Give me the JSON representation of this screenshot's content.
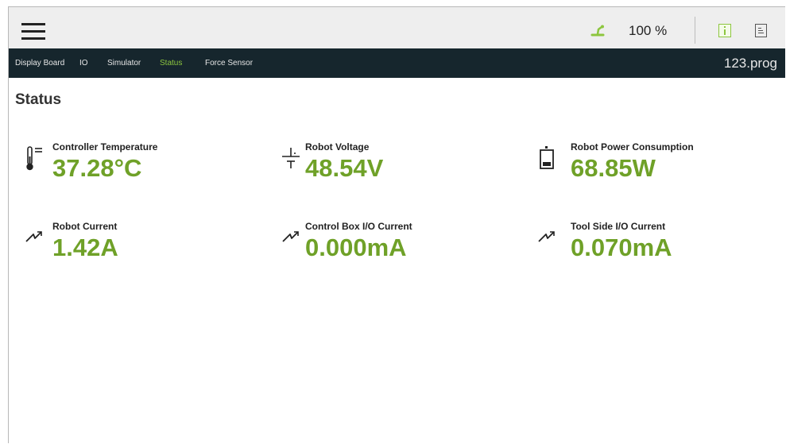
{
  "toolbar": {
    "speed_value": "100 %",
    "icons": [
      "menu-icon",
      "robot-arm-icon",
      "info-icon",
      "log-icon"
    ]
  },
  "nav": {
    "tabs": [
      "Display Board",
      "IO",
      "Simulator",
      "Status",
      "Force Sensor"
    ],
    "active_tab": "Status",
    "program_name": "123.prog"
  },
  "page": {
    "title": "Status"
  },
  "metrics": [
    {
      "label": "Controller Temperature",
      "value": "37.28°C",
      "icon": "thermometer-icon"
    },
    {
      "label": "Robot Voltage",
      "value": "48.54V",
      "icon": "voltage-icon"
    },
    {
      "label": "Robot Power Consumption",
      "value": "68.85W",
      "icon": "battery-icon"
    },
    {
      "label": "Robot Current",
      "value": "1.42A",
      "icon": "current-icon"
    },
    {
      "label": "Control Box I/O Current",
      "value": "0.000mA",
      "icon": "current-icon"
    },
    {
      "label": "Tool Side I/O Current",
      "value": "0.070mA",
      "icon": "current-icon"
    }
  ],
  "colors": {
    "accent": "#8dc63f",
    "value_green": "#6fa128",
    "navbar_bg": "#16262d",
    "topbar_bg": "#eeeeee"
  }
}
